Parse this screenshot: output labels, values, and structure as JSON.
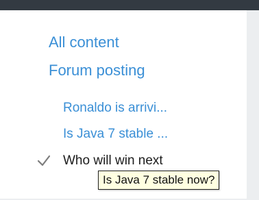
{
  "nav": {
    "all_content": "All content",
    "forum_posting": "Forum posting",
    "items": [
      {
        "label": "Ronaldo is arrivi..."
      },
      {
        "label": "Is Java 7 stable ..."
      },
      {
        "label": "Who will win next",
        "selected": true
      }
    ]
  },
  "tooltip": {
    "text": "Is Java 7 stable now?"
  },
  "icons": {
    "selected_marker": "checkmark-icon"
  },
  "colors": {
    "link": "#3a8fd6",
    "top_bar": "#333a42",
    "tooltip_bg": "#ffffe1"
  }
}
